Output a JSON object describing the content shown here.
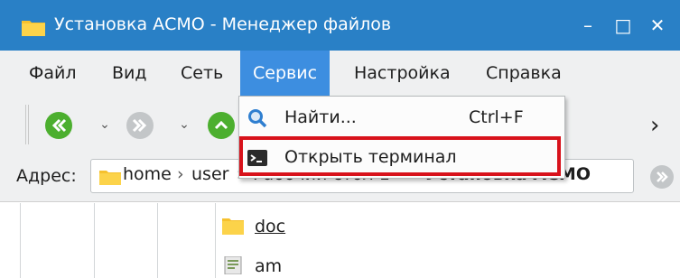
{
  "window": {
    "title": "Установка АСМО - Менеджер файлов",
    "minimize_glyph": "–",
    "maximize_glyph": "□",
    "close_glyph": "✕",
    "accent_color": "#2980c6"
  },
  "menubar": {
    "items": [
      {
        "label": "Файл"
      },
      {
        "label": "Вид"
      },
      {
        "label": "Сеть"
      },
      {
        "label": "Сервис",
        "active": true
      },
      {
        "label": "Настройка"
      },
      {
        "label": "Справка"
      }
    ]
  },
  "toolbar": {
    "buttons": [
      {
        "icon": "back-arrow-icon"
      },
      {
        "icon": "forward-arrow-icon"
      },
      {
        "icon": "up-arrow-icon"
      }
    ],
    "overflow_glyph": "›"
  },
  "service_menu": {
    "items": [
      {
        "icon": "search-icon",
        "label": "Найти...",
        "shortcut": "Ctrl+F"
      },
      {
        "icon": "terminal-icon",
        "label": "Открыть терминал",
        "shortcut": ""
      }
    ],
    "highlight_color": "#d8121b"
  },
  "address": {
    "label": "Адрес:",
    "crumbs": [
      "home",
      "user",
      "Рабочий стол 1",
      "Установка АСМО"
    ]
  },
  "files": [
    {
      "name": "doc",
      "icon": "folder-icon"
    },
    {
      "name": "am",
      "icon": "file-icon"
    }
  ]
}
